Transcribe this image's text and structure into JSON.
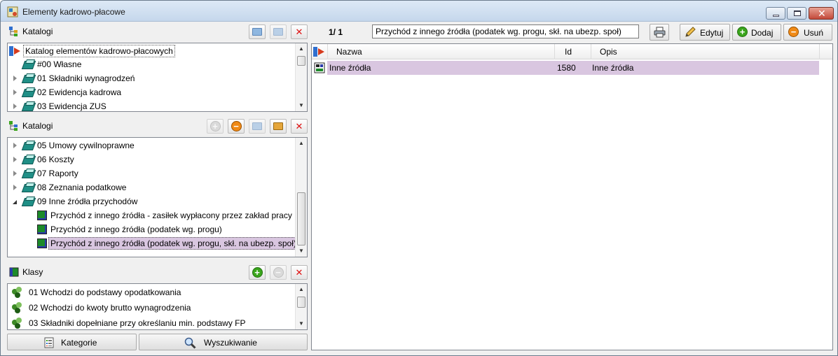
{
  "window": {
    "title": "Elementy kadrowo-płacowe"
  },
  "panel1": {
    "title": "Katalogi",
    "items": [
      {
        "label": "Katalog elementów kadrowo-płacowych",
        "level": 0
      },
      {
        "label": "#00 Własne",
        "level": 1
      },
      {
        "label": "01 Składniki wynagrodzeń",
        "level": 1
      },
      {
        "label": "02 Ewidencja kadrowa",
        "level": 1
      },
      {
        "label": "03 Ewidencja ZUS",
        "level": 1
      }
    ]
  },
  "panel2": {
    "title": "Katalogi",
    "items": [
      {
        "label": "05 Umowy cywilnoprawne"
      },
      {
        "label": "06 Koszty"
      },
      {
        "label": "07 Raporty"
      },
      {
        "label": "08 Zeznania podatkowe"
      },
      {
        "label": "09 Inne źródła przychodów"
      },
      {
        "label": "Przychód z innego źródła - zasiłek wypłacony przez zakład pracy"
      },
      {
        "label": "Przychód z innego źródła (podatek wg. progu)"
      },
      {
        "label": "Przychód z innego źródła (podatek wg. progu, skł. na ubezp. społ)"
      }
    ]
  },
  "panel3": {
    "title": "Klasy",
    "items": [
      {
        "label": "01 Wchodzi do podstawy opodatkowania"
      },
      {
        "label": "02 Wchodzi do kwoty brutto wynagrodzenia"
      },
      {
        "label": "03 Składniki dopełniane przy określaniu min. podstawy FP"
      }
    ]
  },
  "bottom": {
    "categories_label": "Kategorie",
    "search_label": "Wyszukiwanie"
  },
  "toolbar": {
    "counter": "1/ 1",
    "filter_value": "Przychód z innego źródła (podatek wg. progu, skł. na ubezp. społ)",
    "edit_label": "Edytuj",
    "add_label": "Dodaj",
    "delete_label": "Usuń"
  },
  "grid": {
    "columns": [
      "Nazwa",
      "Id",
      "Opis"
    ],
    "rows": [
      {
        "nazwa": "Inne źródła",
        "id": "1580",
        "opis": "Inne źródła"
      }
    ]
  },
  "colors": {
    "selection": "#d9c6e0",
    "accent_green": "#3aa51c",
    "accent_orange": "#f08a16",
    "close_red": "#d11111"
  }
}
